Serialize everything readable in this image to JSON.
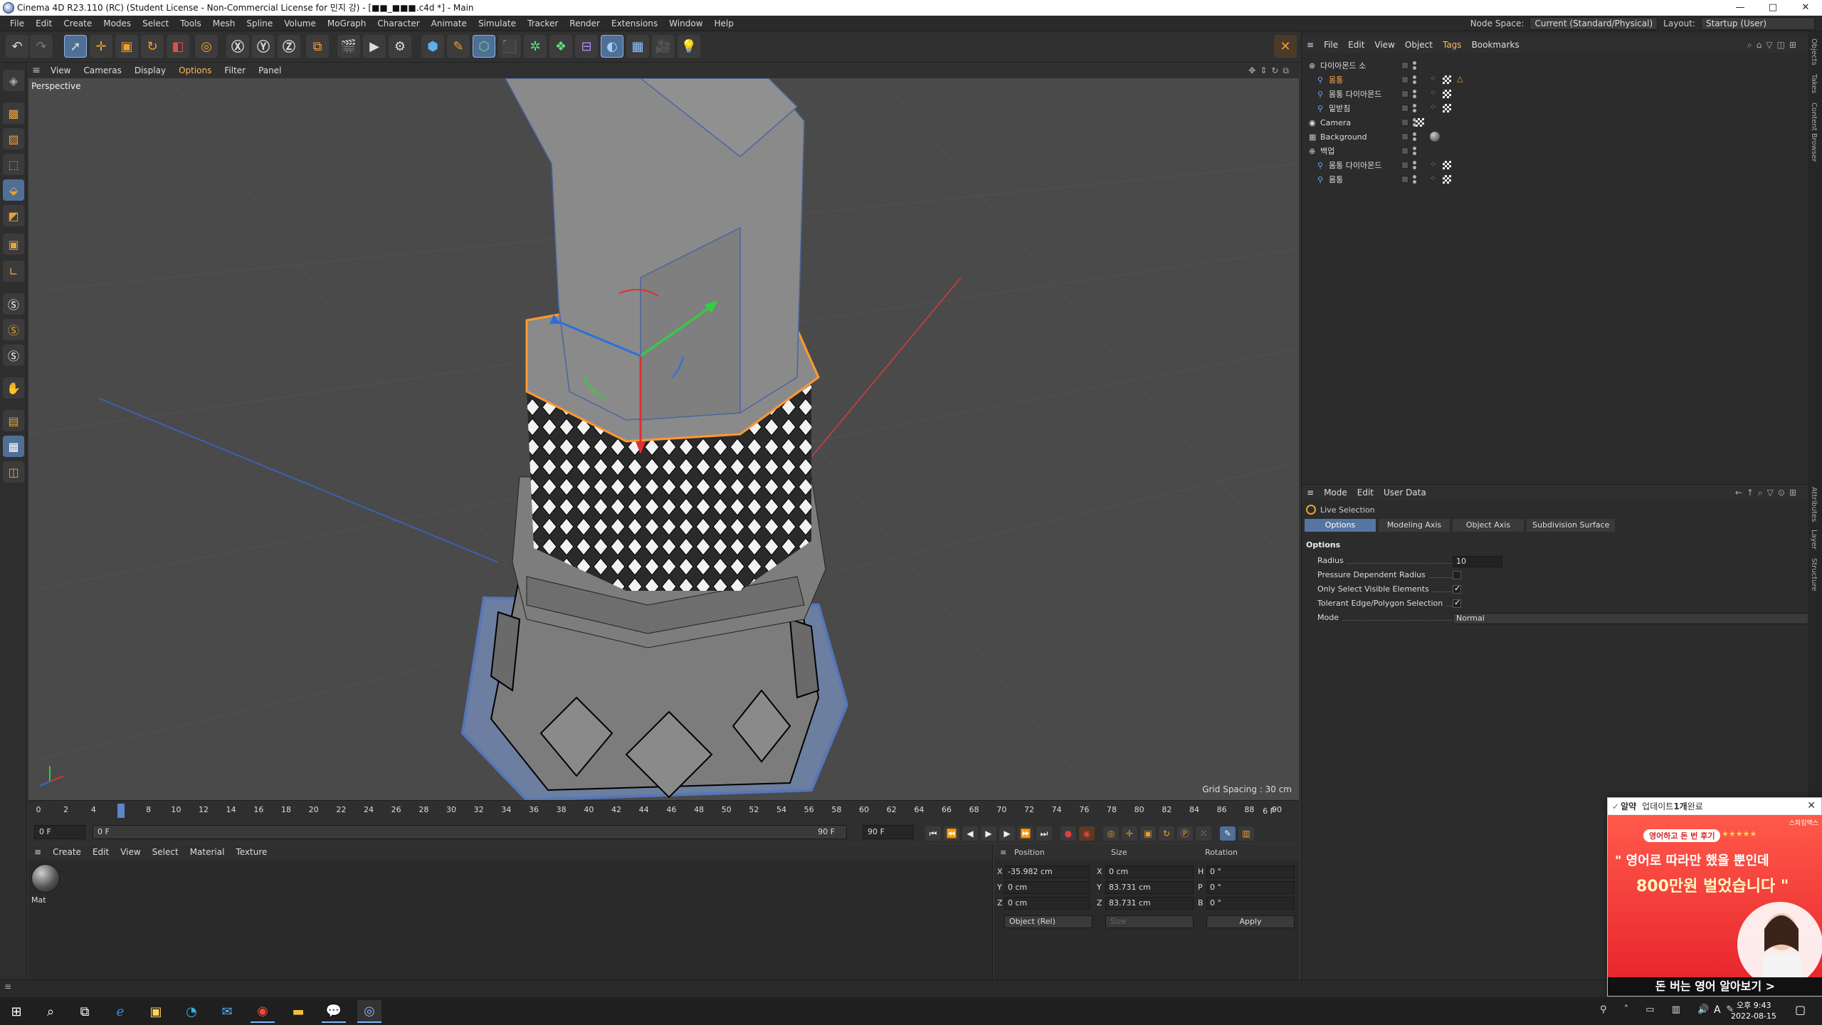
{
  "window": {
    "title": "Cinema 4D R23.110 (RC) (Student License - Non-Commercial License for 민지 강) - [■■_■■■.c4d *] - Main",
    "controls": [
      "—",
      "□",
      "✕"
    ]
  },
  "menubar": {
    "items": [
      "File",
      "Edit",
      "Create",
      "Modes",
      "Select",
      "Tools",
      "Mesh",
      "Spline",
      "Volume",
      "MoGraph",
      "Character",
      "Animate",
      "Simulate",
      "Tracker",
      "Render",
      "Extensions",
      "Window",
      "Help"
    ],
    "node_space_label": "Node Space:",
    "node_space_value": "Current (Standard/Physical)",
    "layout_label": "Layout:",
    "layout_value": "Startup (User)"
  },
  "viewport": {
    "menu": [
      "View",
      "Cameras",
      "Display",
      "Options",
      "Filter",
      "Panel"
    ],
    "active_menu": "Options",
    "label": "Perspective",
    "grid_spacing": "Grid Spacing : 30 cm"
  },
  "timeline": {
    "ticks": [
      "0",
      "2",
      "4",
      "6",
      "8",
      "10",
      "12",
      "14",
      "16",
      "18",
      "20",
      "22",
      "24",
      "26",
      "28",
      "30",
      "32",
      "34",
      "36",
      "38",
      "40",
      "42",
      "44",
      "46",
      "48",
      "50",
      "52",
      "54",
      "56",
      "58",
      "60",
      "62",
      "64",
      "66",
      "68",
      "70",
      "72",
      "74",
      "76",
      "78",
      "80",
      "82",
      "84",
      "86",
      "88",
      "90"
    ],
    "current_frame": "6 F",
    "start_field": "0 F",
    "range_start": "0 F",
    "range_end": "90 F",
    "end_field": "90 F",
    "playhead_fraction": 0.0667
  },
  "material_panel": {
    "menu": [
      "Create",
      "Edit",
      "View",
      "Select",
      "Material",
      "Texture"
    ],
    "materials": [
      {
        "name": "Mat"
      }
    ]
  },
  "coordinates": {
    "headers": [
      "Position",
      "Size",
      "Rotation"
    ],
    "rows": [
      {
        "axis": "X",
        "pos": "-35.982 cm",
        "size_axis": "X",
        "size": "0 cm",
        "rot_axis": "H",
        "rot": "0 °"
      },
      {
        "axis": "Y",
        "pos": "0 cm",
        "size_axis": "Y",
        "size": "83.731 cm",
        "rot_axis": "P",
        "rot": "0 °"
      },
      {
        "axis": "Z",
        "pos": "0 cm",
        "size_axis": "Z",
        "size": "83.731 cm",
        "rot_axis": "B",
        "rot": "0 °"
      }
    ],
    "mode": "Object (Rel)",
    "size_mode": "Size",
    "apply": "Apply"
  },
  "object_manager": {
    "menu": [
      "File",
      "Edit",
      "View",
      "Object",
      "Tags",
      "Bookmarks"
    ],
    "active_menu": "Tags",
    "objects": [
      {
        "name": "다이아몬드 소",
        "indent": 0,
        "selected": false,
        "icon": "null-icon"
      },
      {
        "name": "몸통",
        "indent": 1,
        "selected": true,
        "icon": "figure-icon"
      },
      {
        "name": "몸통 다이아몬드",
        "indent": 1,
        "selected": false,
        "icon": "figure-icon"
      },
      {
        "name": "밑받침",
        "indent": 1,
        "selected": false,
        "icon": "figure-icon"
      },
      {
        "name": "Camera",
        "indent": 0,
        "selected": false,
        "icon": "camera-icon"
      },
      {
        "name": "Background",
        "indent": 0,
        "selected": false,
        "icon": "background-icon"
      },
      {
        "name": "백업",
        "indent": 0,
        "selected": false,
        "icon": "null-icon"
      },
      {
        "name": "몸통 다이아몬드",
        "indent": 1,
        "selected": false,
        "icon": "figure-icon"
      },
      {
        "name": "몸통",
        "indent": 1,
        "selected": false,
        "icon": "figure-icon"
      }
    ]
  },
  "attributes": {
    "menu": [
      "Mode",
      "Edit",
      "User Data"
    ],
    "tool_name": "Live Selection",
    "tabs": [
      "Options",
      "Modeling Axis",
      "Object Axis",
      "Subdivision Surface"
    ],
    "active_tab": "Options",
    "section": "Options",
    "fields": {
      "radius_label": "Radius",
      "radius_value": "10",
      "pressure_label": "Pressure Dependent Radius",
      "visible_label": "Only Select Visible Elements",
      "tolerant_label": "Tolerant Edge/Polygon Selection",
      "mode_label": "Mode",
      "mode_value": "Normal"
    }
  },
  "side_tabs": [
    "Objects",
    "Takes",
    "Content Browser",
    "Attributes",
    "Layer",
    "Structure"
  ],
  "ad": {
    "brand": "알약",
    "notice_prefix": "업데이트 ",
    "notice_bold": "1개",
    "notice_suffix": " 완료",
    "sponsor": "스피킹맥스",
    "tag": "영어하고 돈 번 후기",
    "stars": "★★★★★",
    "headline1": "\" 영어로 따라만 했을 뿐인데",
    "headline2": "800만원 벌었습니다 \"",
    "cta": "돈 버는 영어 알아보기 >"
  },
  "taskbar": {
    "time": "오후 9:43",
    "date": "2022-08-15",
    "lang": "A"
  },
  "colors": {
    "accent": "#ffa84a",
    "selection": "#5675a1",
    "viewport_bg": "#4a4a4a"
  }
}
